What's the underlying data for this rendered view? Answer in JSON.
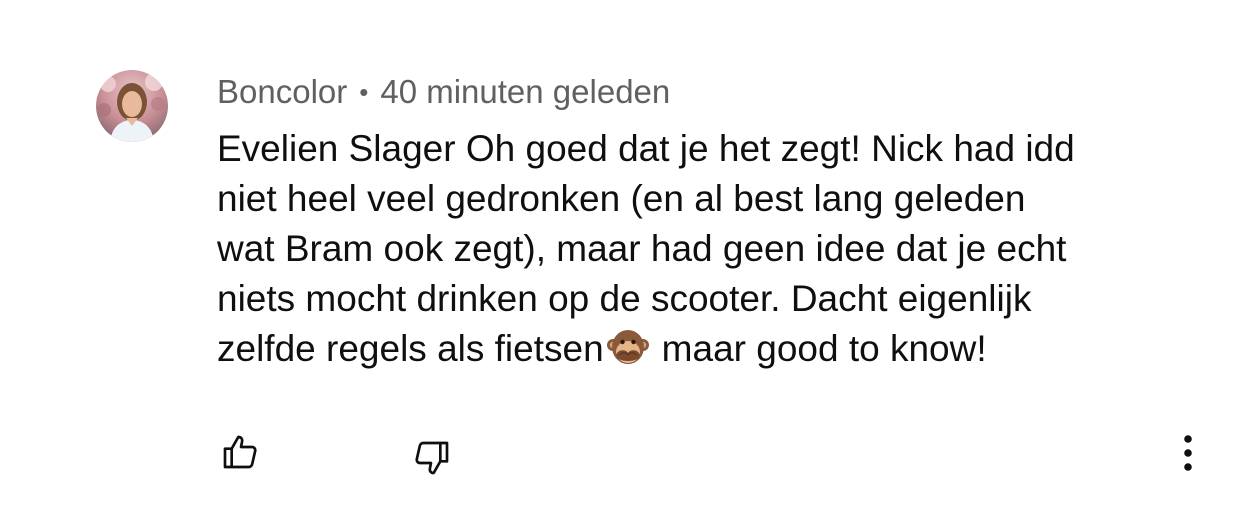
{
  "comment": {
    "author": "Boncolor",
    "separator": "•",
    "timestamp": "40 minuten geleden",
    "text_lines": [
      "Evelien Slager Oh goed dat je het zegt! Nick had idd",
      "niet heel veel gedronken (en al best lang geleden",
      "wat Bram ook zegt), maar had geen idee dat je echt",
      "niets mocht drinken op de scooter. Dacht eigenlijk",
      "zelfde regels als fietsen"
    ],
    "text_tail": "maar good to know!",
    "emoji": "see-no-evil-monkey",
    "avatar": "profile-photo"
  },
  "actions": {
    "like_icon": "thumbs-up-icon",
    "dislike_icon": "thumbs-down-icon",
    "more_icon": "vertical-ellipsis-icon"
  },
  "colors": {
    "meta_text": "#606060",
    "body_text": "#0f0f0f",
    "background": "#ffffff"
  }
}
